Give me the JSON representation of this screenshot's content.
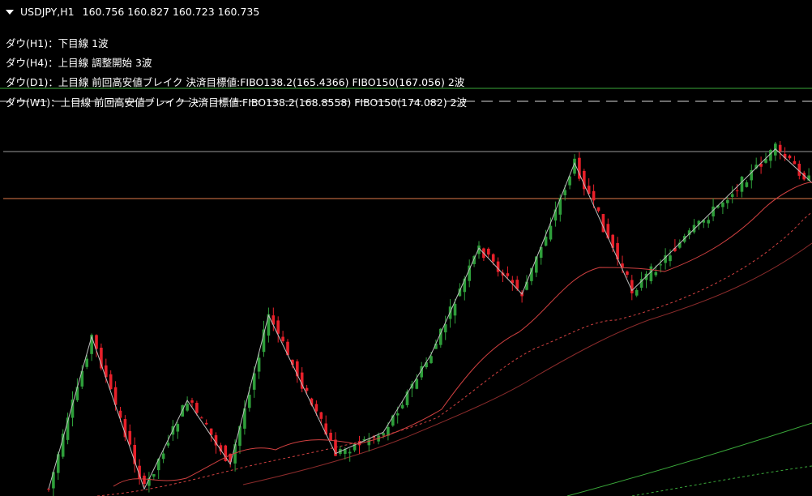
{
  "header": {
    "symbol": "USDJPY,H1",
    "prices": "160.756 160.827 160.723 160.735"
  },
  "indicators": [
    {
      "text": "ダウ(H1)：下目線 1波"
    },
    {
      "text": "ダウ(H4)：上目線 調整開始 3波"
    },
    {
      "text": "ダウ(D1)：上目線 前回高安値ブレイク 決済目標値:FIBO138.2(165.4366) FIBO150(167.056) 2波"
    },
    {
      "text": "ダウ(W1)：上目線 前回高安値ブレイク 決済目標値:FIBO138.2(168.8558) FIBO150(174.082) 2波"
    }
  ],
  "colors": {
    "background": "#000000",
    "bull": "#2e9e3a",
    "bear": "#e8202a",
    "zigzag": "#bdbdbd",
    "ma_fast": "#d04040",
    "ma_slow": "#8a2b2b",
    "green_level": "#3aa83a",
    "gray_level": "#9a9a9a",
    "orange_level": "#e07a4a",
    "dash_level": "#e05030"
  },
  "chart_data": {
    "type": "candlestick",
    "zigzag_turning_points": [
      {
        "i": 0,
        "y": 0.98
      },
      {
        "i": 9,
        "y": 0.55
      },
      {
        "i": 20,
        "y": 0.98
      },
      {
        "i": 29,
        "y": 0.73
      },
      {
        "i": 38,
        "y": 0.91
      },
      {
        "i": 46,
        "y": 0.49
      },
      {
        "i": 60,
        "y": 0.88
      },
      {
        "i": 70,
        "y": 0.82
      },
      {
        "i": 80,
        "y": 0.6
      },
      {
        "i": 90,
        "y": 0.3
      },
      {
        "i": 99,
        "y": 0.43
      },
      {
        "i": 110,
        "y": 0.06
      },
      {
        "i": 122,
        "y": 0.42
      },
      {
        "i": 152,
        "y": 0.02
      },
      {
        "i": 160,
        "y": 0.12
      }
    ]
  }
}
